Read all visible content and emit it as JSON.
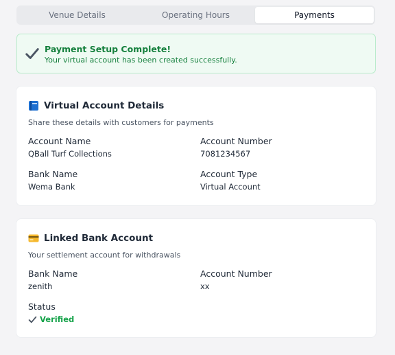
{
  "tabs": [
    {
      "label": "Venue Details"
    },
    {
      "label": "Operating Hours"
    },
    {
      "label": "Payments",
      "active": true
    }
  ],
  "alert": {
    "title": "Payment Setup Complete!",
    "message": "Your virtual account has been created successfully.",
    "icon": "checkmark-icon"
  },
  "virtual_account": {
    "icon": "blue-book-icon",
    "title": "Virtual Account Details",
    "subtitle": "Share these details with customers for payments",
    "fields": [
      {
        "label": "Account Name",
        "value": "QBall Turf Collections"
      },
      {
        "label": "Account Number",
        "value": "7081234567"
      },
      {
        "label": "Bank Name",
        "value": "Wema Bank"
      },
      {
        "label": "Account Type",
        "value": "Virtual Account"
      }
    ]
  },
  "linked_account": {
    "icon": "credit-card-icon",
    "title": "Linked Bank Account",
    "subtitle": "Your settlement account for withdrawals",
    "fields": [
      {
        "label": "Bank Name",
        "value": "zenith"
      },
      {
        "label": "Account Number",
        "value": "xx"
      },
      {
        "label": "Status",
        "value": "Verified"
      }
    ]
  },
  "colors": {
    "success": "#16a34a",
    "success_bg": "#effaf3",
    "success_border": "#b9ebcb",
    "page_bg": "#f4f4f6"
  }
}
